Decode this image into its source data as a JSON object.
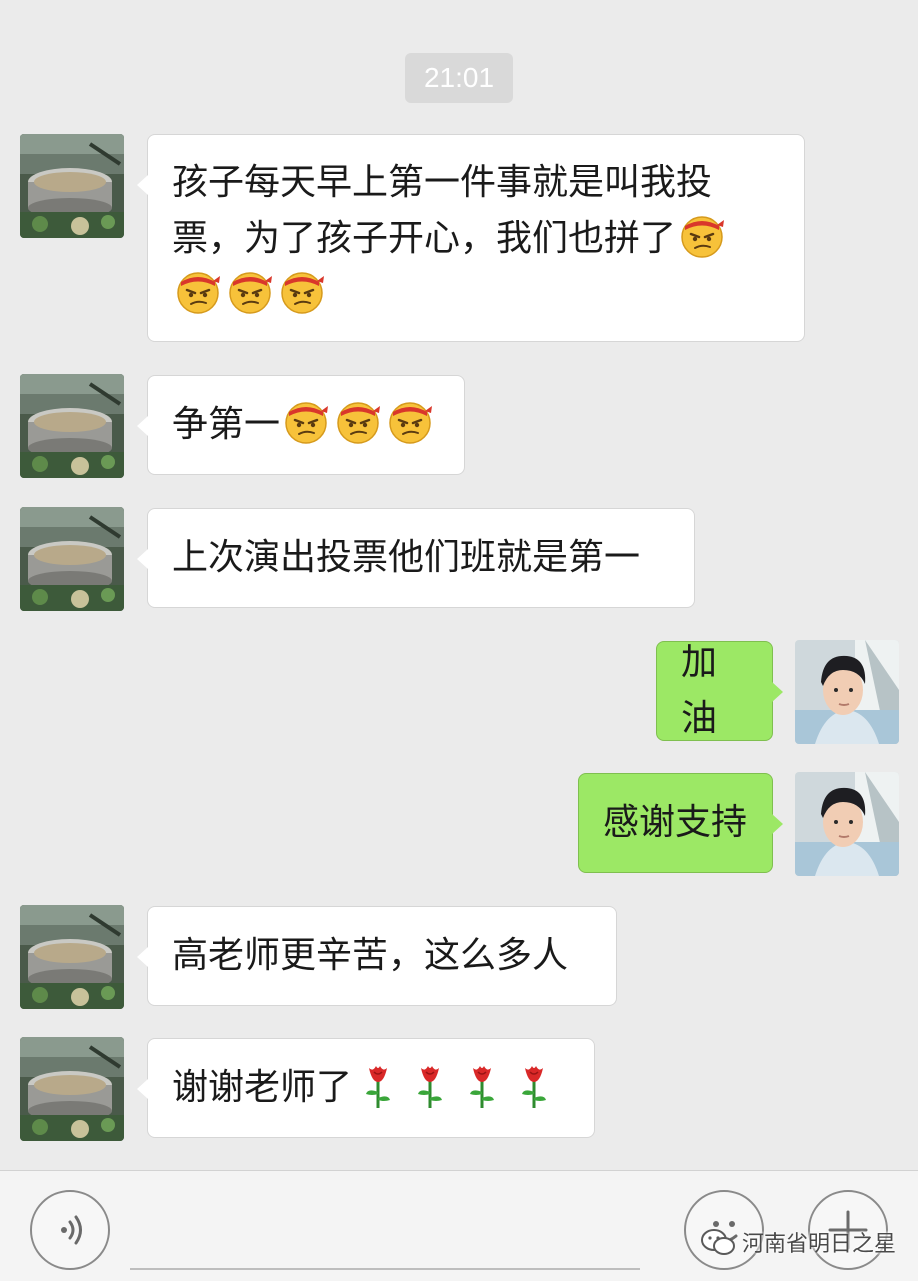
{
  "chat": {
    "timestamp": "21:01",
    "messages": [
      {
        "side": "left",
        "text": "孩子每天早上第一件事就是叫我投票，为了孩子开心，我们也拼了",
        "emoji": "determined-face-emoji",
        "emoji_count": 4
      },
      {
        "side": "left",
        "text": "争第一",
        "emoji": "determined-face-emoji",
        "emoji_count": 3
      },
      {
        "side": "left",
        "text": "上次演出投票他们班就是第一"
      },
      {
        "side": "right",
        "text": "加油"
      },
      {
        "side": "right",
        "text": "感谢支持"
      },
      {
        "side": "left",
        "text": "高老师更辛苦，这么多人"
      },
      {
        "side": "left",
        "text": "谢谢老师了",
        "emoji": "rose-emoji",
        "emoji_count": 4
      }
    ]
  },
  "input_bar": {
    "voice_icon": "voice-icon",
    "emoji_icon": "smiley-icon",
    "plus_icon": "plus-icon"
  },
  "watermark": {
    "text": "河南省明日之星",
    "icon": "wechat-logo-icon"
  },
  "colors": {
    "background": "#ebebeb",
    "bubble_left": "#ffffff",
    "bubble_right": "#9ce865"
  }
}
